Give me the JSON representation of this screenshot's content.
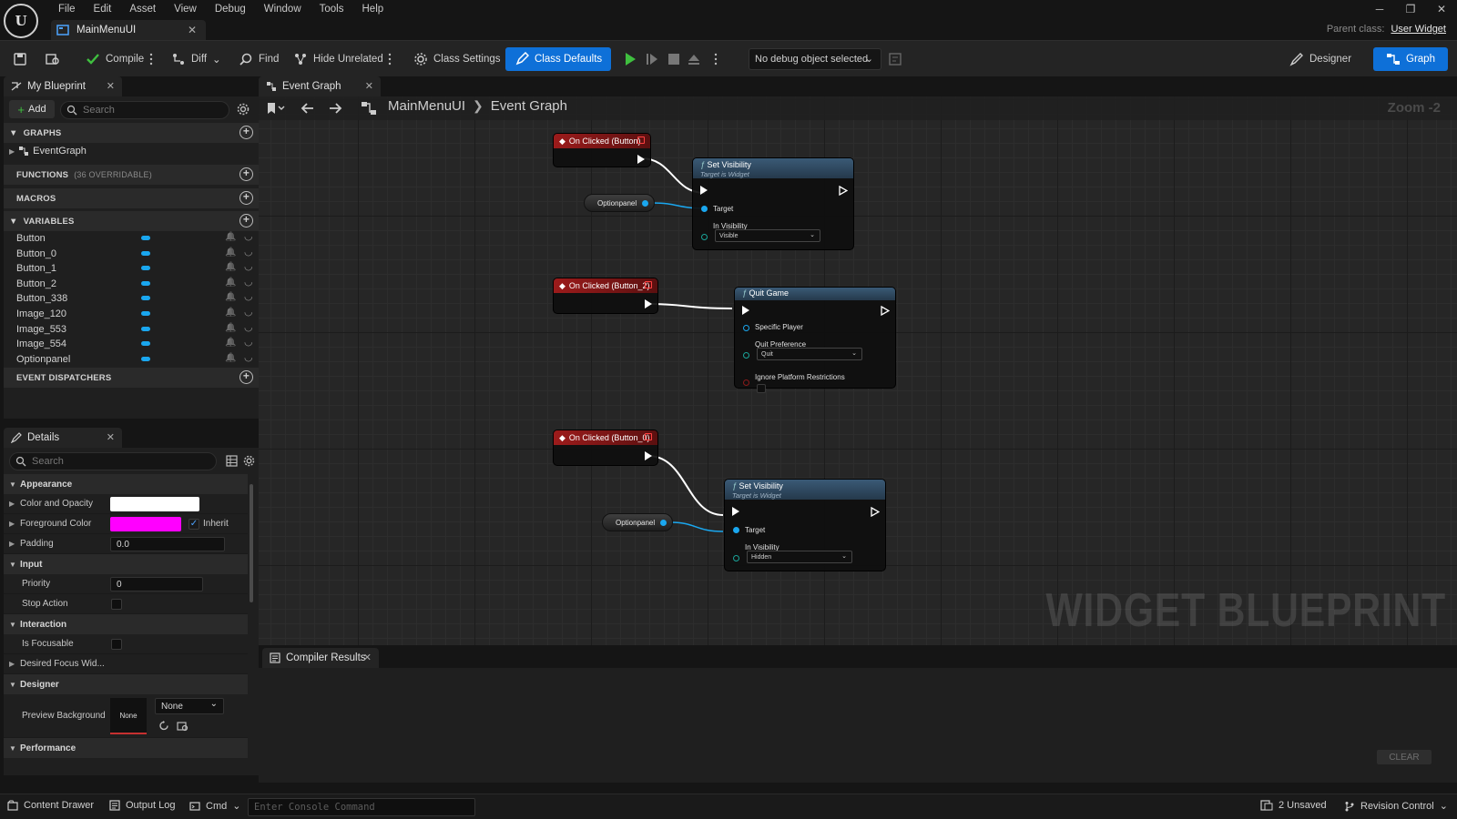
{
  "menu": [
    "File",
    "Edit",
    "Asset",
    "View",
    "Debug",
    "Window",
    "Tools",
    "Help"
  ],
  "document_tab": {
    "label": "MainMenuUI"
  },
  "parent_class": {
    "label": "Parent class:",
    "value": "User Widget"
  },
  "toolbar": {
    "compile": "Compile",
    "diff": "Diff",
    "find": "Find",
    "hide_unrelated": "Hide Unrelated",
    "class_settings": "Class Settings",
    "class_defaults": "Class Defaults",
    "debug_object": "No debug object selected",
    "designer": "Designer",
    "graph": "Graph"
  },
  "my_blueprint": {
    "tab": "My Blueprint",
    "add": "Add",
    "search_placeholder": "Search",
    "sections": {
      "graphs": "GRAPHS",
      "functions": "FUNCTIONS",
      "functions_sub": "(36 OVERRIDABLE)",
      "macros": "MACROS",
      "variables": "VARIABLES",
      "event_dispatchers": "EVENT DISPATCHERS"
    },
    "graph_item": "EventGraph",
    "variables": [
      "Button",
      "Button_0",
      "Button_1",
      "Button_2",
      "Button_338",
      "Image_120",
      "Image_553",
      "Image_554",
      "Optionpanel"
    ]
  },
  "details": {
    "tab": "Details",
    "search_placeholder": "Search",
    "appearance": "Appearance",
    "color_and_opacity": "Color and Opacity",
    "foreground_color": "Foreground Color",
    "inherit": "Inherit",
    "padding": "Padding",
    "padding_value": "0.0",
    "input": "Input",
    "priority": "Priority",
    "priority_value": "0",
    "stop_action": "Stop Action",
    "interaction": "Interaction",
    "is_focusable": "Is Focusable",
    "desired_focus": "Desired Focus Wid...",
    "designer": "Designer",
    "preview_background": "Preview Background",
    "preview_none": "None",
    "preview_select": "None",
    "performance": "Performance"
  },
  "colors": {
    "accent": "#0e70d8",
    "foreground_color": "#ff00ff",
    "color_and_opacity": "#ffffff",
    "variable_pin": "#1aa7ef",
    "event_header": "#9c1b1b"
  },
  "graph": {
    "tab": "Event Graph",
    "breadcrumb_root": "MainMenuUI",
    "breadcrumb_leaf": "Event Graph",
    "zoom": "Zoom -2",
    "watermark": "WIDGET BLUEPRINT",
    "nodes": {
      "event1": "On Clicked (Button)",
      "event2": "On Clicked (Button_2)",
      "event3": "On Clicked (Button_0)",
      "setvis1_title": "Set Visibility",
      "setvis1_sub": "Target is Widget",
      "setvis1_target": "Target",
      "setvis1_invis": "In Visibility",
      "setvis1_value": "Visible",
      "quit_title": "Quit Game",
      "quit_player": "Specific Player",
      "quit_pref": "Quit Preference",
      "quit_value": "Quit",
      "quit_ignore": "Ignore Platform Restrictions",
      "setvis2_title": "Set Visibility",
      "setvis2_sub": "Target is Widget",
      "setvis2_target": "Target",
      "setvis2_invis": "In Visibility",
      "setvis2_value": "Hidden",
      "optionpanel1": "Optionpanel",
      "optionpanel2": "Optionpanel"
    }
  },
  "compiler": {
    "tab": "Compiler Results",
    "clear": "CLEAR"
  },
  "statusbar": {
    "content_drawer": "Content Drawer",
    "output_log": "Output Log",
    "cmd": "Cmd",
    "console_placeholder": "Enter Console Command",
    "unsaved": "2 Unsaved",
    "revision_control": "Revision Control"
  }
}
